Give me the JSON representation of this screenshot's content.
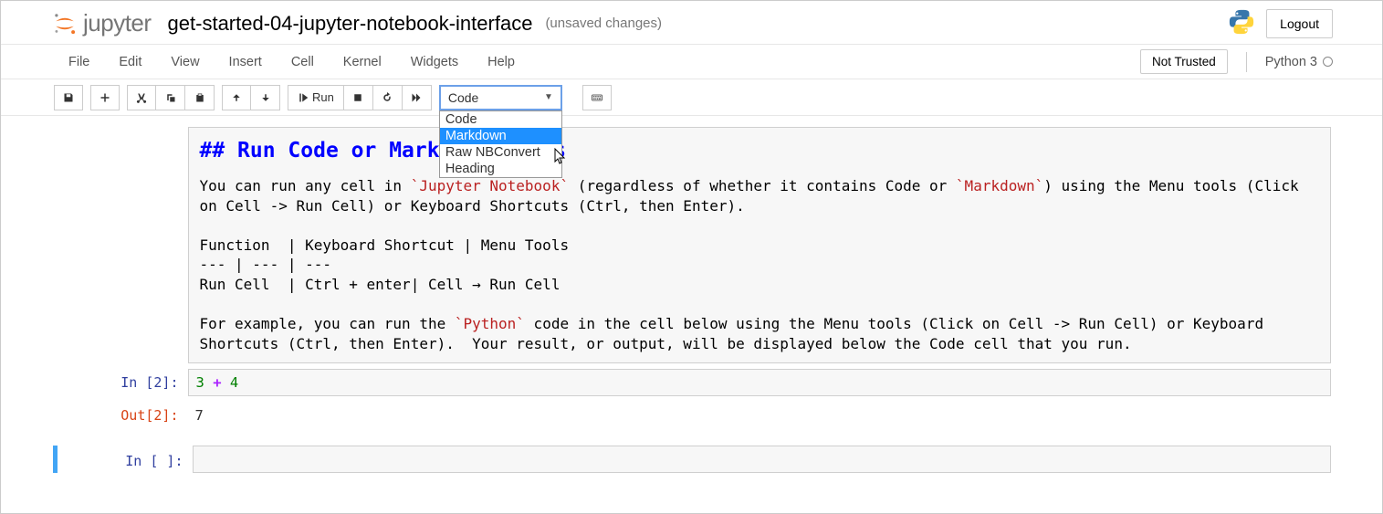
{
  "header": {
    "logo_text": "jupyter",
    "notebook_title": "get-started-04-jupyter-notebook-interface",
    "save_status": "(unsaved changes)",
    "logout": "Logout"
  },
  "menubar": {
    "items": [
      "File",
      "Edit",
      "View",
      "Insert",
      "Cell",
      "Kernel",
      "Widgets",
      "Help"
    ],
    "trust": "Not Trusted",
    "kernel": "Python 3"
  },
  "toolbar": {
    "run_label": "Run",
    "cell_type_selected": "Code",
    "cell_type_options": [
      "Code",
      "Markdown",
      "Raw NBConvert",
      "Heading"
    ],
    "highlighted_index": 1
  },
  "cells": {
    "markdown": {
      "heading": "## Run Code or Markdown Cells",
      "body": "You can run any cell in `Jupyter Notebook` (regardless of whether it contains Code or `Markdown`) using the Menu tools (Click on Cell -> Run Cell) or Keyboard Shortcuts (Ctrl, then Enter).\n\nFunction  | Keyboard Shortcut | Menu Tools\n--- | --- | ---\nRun Cell  | Ctrl + enter| Cell → Run Cell\n\nFor example, you can run the `Python` code in the cell below using the Menu tools (Click on Cell -> Run Cell) or Keyboard Shortcuts (Ctrl, then Enter).  Your result, or output, will be displayed below the Code cell that you run."
    },
    "code": {
      "in_prompt": "In [2]:",
      "source_a": "3",
      "source_op": "+",
      "source_b": "4",
      "out_prompt": "Out[2]:",
      "out_value": "7"
    },
    "empty": {
      "prompt": "In [ ]:"
    }
  }
}
